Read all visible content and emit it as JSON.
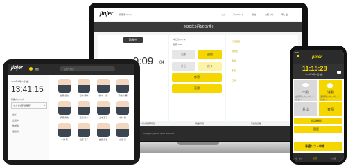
{
  "laptop": {
    "logo": "jinjer",
    "logo_sub": "勤怠",
    "page_name": "管理者ページ",
    "nav_items": [
      "トップ",
      "アカウント",
      "勤怠",
      "お知らせ",
      "申し出"
    ],
    "date_banner": "2020年6月12日(金)",
    "status_badge": "勤務中",
    "time_value": "9:09",
    "time_seconds": "04",
    "schedule_lines": [
      "本日のシフト",
      "勤務 9:00"
    ],
    "buttons": {
      "clock_in": "出勤",
      "clock_out": "退勤",
      "break_start": "休憩",
      "break_end": "休憩",
      "leave": "外出",
      "return": "戻り",
      "direct": "直帰"
    },
    "side_menu": [
      "打刻履歴",
      "勤務表",
      "申請",
      "予定",
      "日報"
    ],
    "summary_labels": [
      "今月の勤務時間",
      "残業時間",
      "有給残日数"
    ],
    "footer_text": "Copyright jinjer All rights reserved."
  },
  "tablet": {
    "logo": "jinjer",
    "header_label": "勤怠",
    "search_placeholder": "名前を検索",
    "date": "2020年6月12日(金)",
    "clock": "13:41:15",
    "group_label": "所属グループ",
    "group_value": "なんでも部 営業部",
    "menu": [
      "全て",
      "出勤中",
      "休憩中",
      "退勤済"
    ],
    "employees": [
      "佐藤 健太",
      "田中 美咲",
      "鈴木 一郎",
      "高橋 大輔",
      "伊藤 翔太",
      "渡辺 陽介",
      "山本 直子",
      "中村 優",
      "小林 聡",
      "加藤 花子",
      "吉田 拓也",
      "山田 恵"
    ]
  },
  "phone": {
    "status_time": "9:41",
    "logo": "jinjer",
    "clock": "11:15:28",
    "date": "2020年6月12日(金)",
    "buttons": {
      "clock_in": "出勤",
      "clock_in_sub": "出勤時にタップしてください",
      "clock_out": "退勤",
      "clock_out_sub": "退勤時にタップしてください",
      "leave": "外出",
      "return": "直帰",
      "request": "申請機能",
      "history": "履歴",
      "shift": "希望シフト申請"
    },
    "tabs": [
      "ホーム",
      "打刻",
      "その他"
    ]
  }
}
